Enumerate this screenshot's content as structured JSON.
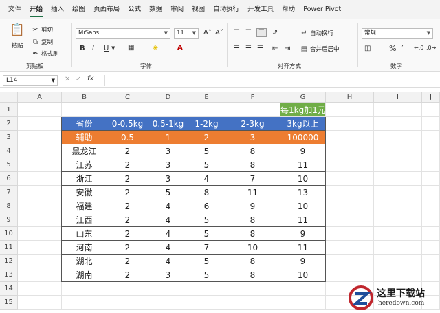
{
  "menu": [
    "文件",
    "开始",
    "插入",
    "绘图",
    "页面布局",
    "公式",
    "数据",
    "审阅",
    "视图",
    "自动执行",
    "开发工具",
    "帮助",
    "Power Pivot"
  ],
  "clipboard": {
    "paste": "粘贴",
    "cut": "剪切",
    "copy": "复制",
    "format_painter": "格式刷",
    "label": "剪贴板"
  },
  "font": {
    "name": "MiSans",
    "size": "11",
    "bold": "B",
    "italic": "I",
    "underline": "U",
    "label": "字体"
  },
  "alignment": {
    "wrap": "自动换行",
    "merge": "合并后居中",
    "label": "对齐方式"
  },
  "number": {
    "format": "常规",
    "percent": "%",
    "label": "数字"
  },
  "formula_bar": {
    "cell_ref": "L14",
    "fx": "fx"
  },
  "columns": [
    "A",
    "B",
    "C",
    "D",
    "E",
    "F",
    "G",
    "H",
    "I",
    "J"
  ],
  "rows": [
    "1",
    "2",
    "3",
    "4",
    "5",
    "6",
    "7",
    "8",
    "9",
    "10",
    "11",
    "12",
    "13",
    "14",
    "15"
  ],
  "note": "每1kg加1元",
  "table": {
    "header": [
      "省份",
      "0-0.5kg",
      "0.5-1kg",
      "1-2kg",
      "2-3kg",
      "3kg以上"
    ],
    "aux": [
      "辅助",
      "0.5",
      "1",
      "2",
      "3",
      "100000"
    ],
    "rows": [
      [
        "黑龙江",
        "2",
        "3",
        "5",
        "8",
        "9"
      ],
      [
        "江苏",
        "2",
        "3",
        "5",
        "8",
        "11"
      ],
      [
        "浙江",
        "2",
        "3",
        "4",
        "7",
        "10"
      ],
      [
        "安徽",
        "2",
        "5",
        "8",
        "11",
        "13"
      ],
      [
        "福建",
        "2",
        "4",
        "6",
        "9",
        "10"
      ],
      [
        "江西",
        "2",
        "4",
        "5",
        "8",
        "11"
      ],
      [
        "山东",
        "2",
        "4",
        "5",
        "8",
        "9"
      ],
      [
        "河南",
        "2",
        "4",
        "7",
        "10",
        "11"
      ],
      [
        "湖北",
        "2",
        "4",
        "5",
        "8",
        "9"
      ],
      [
        "湖南",
        "2",
        "3",
        "5",
        "8",
        "10"
      ]
    ]
  },
  "watermark": {
    "title": "这里下载站",
    "url": "heredown.com"
  },
  "colors": {
    "header": "#4472c4",
    "aux": "#ed7d31",
    "note": "#70ad47",
    "accent": "#1e7145"
  }
}
